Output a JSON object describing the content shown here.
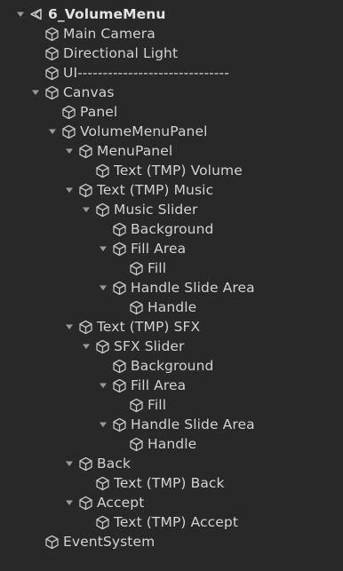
{
  "hierarchy": {
    "scene": {
      "label": "6_VolumeMenu",
      "icon": "unity-scene-icon"
    },
    "items": [
      {
        "label": "Main Camera",
        "icon": "gameobject-cube-icon"
      },
      {
        "label": "Directional Light",
        "icon": "gameobject-cube-icon"
      },
      {
        "label": "UI------------------------------",
        "icon": "gameobject-cube-icon"
      },
      {
        "label": "Canvas",
        "icon": "gameobject-cube-icon",
        "expanded": true
      },
      {
        "label": "Panel",
        "icon": "gameobject-cube-icon"
      },
      {
        "label": "VolumeMenuPanel",
        "icon": "gameobject-cube-icon",
        "expanded": true
      },
      {
        "label": "MenuPanel",
        "icon": "gameobject-cube-icon",
        "expanded": true
      },
      {
        "label": "Text (TMP) Volume",
        "icon": "gameobject-cube-icon"
      },
      {
        "label": "Text (TMP) Music",
        "icon": "gameobject-cube-icon",
        "expanded": true
      },
      {
        "label": "Music Slider",
        "icon": "gameobject-cube-icon",
        "expanded": true
      },
      {
        "label": "Background",
        "icon": "gameobject-cube-icon"
      },
      {
        "label": "Fill Area",
        "icon": "gameobject-cube-icon",
        "expanded": true
      },
      {
        "label": "Fill",
        "icon": "gameobject-cube-icon"
      },
      {
        "label": "Handle Slide Area",
        "icon": "gameobject-cube-icon",
        "expanded": true
      },
      {
        "label": "Handle",
        "icon": "gameobject-cube-icon"
      },
      {
        "label": "Text (TMP) SFX",
        "icon": "gameobject-cube-icon",
        "expanded": true
      },
      {
        "label": "SFX Slider",
        "icon": "gameobject-cube-icon",
        "expanded": true
      },
      {
        "label": "Background",
        "icon": "gameobject-cube-icon"
      },
      {
        "label": "Fill Area",
        "icon": "gameobject-cube-icon",
        "expanded": true
      },
      {
        "label": "Fill",
        "icon": "gameobject-cube-icon"
      },
      {
        "label": "Handle Slide Area",
        "icon": "gameobject-cube-icon",
        "expanded": true
      },
      {
        "label": "Handle",
        "icon": "gameobject-cube-icon"
      },
      {
        "label": "Back",
        "icon": "gameobject-cube-icon",
        "expanded": true
      },
      {
        "label": "Text (TMP) Back",
        "icon": "gameobject-cube-icon"
      },
      {
        "label": "Accept",
        "icon": "gameobject-cube-icon",
        "expanded": true
      },
      {
        "label": "Text (TMP) Accept",
        "icon": "gameobject-cube-icon"
      },
      {
        "label": "EventSystem",
        "icon": "gameobject-cube-icon"
      }
    ]
  },
  "colors": {
    "background": "#282828",
    "text": "#d2d2d2",
    "arrow": "#9a9a9a",
    "icon": "#c4c4c4"
  }
}
